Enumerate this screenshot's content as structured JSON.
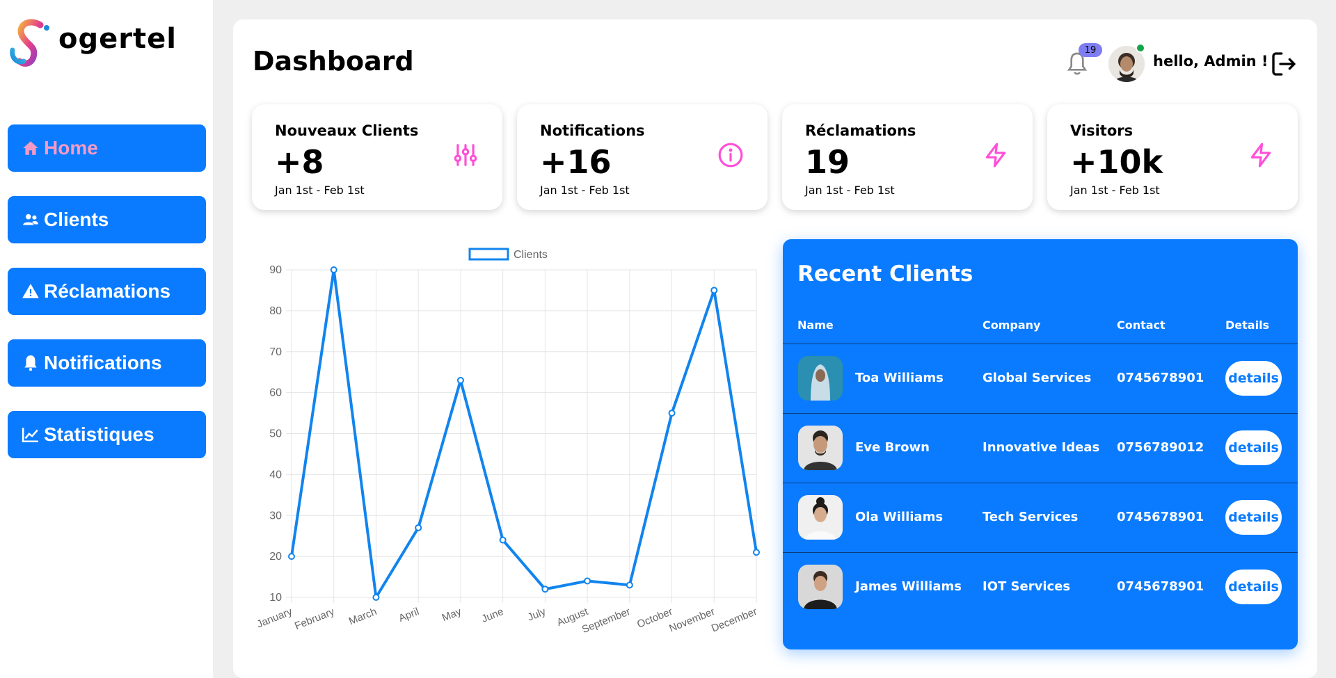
{
  "brand": {
    "name": "ogertel"
  },
  "sidebar": {
    "items": [
      {
        "label": "Home",
        "icon": "home-icon",
        "active": true
      },
      {
        "label": "Clients",
        "icon": "users-icon"
      },
      {
        "label": "Réclamations",
        "icon": "warning-icon"
      },
      {
        "label": "Notifications",
        "icon": "bell-icon"
      },
      {
        "label": "Statistiques",
        "icon": "chart-line-icon"
      }
    ]
  },
  "header": {
    "title": "Dashboard",
    "notification_count": "19",
    "greeting": "hello, Admin !"
  },
  "cards": [
    {
      "label": "Nouveaux Clients",
      "value": "+8",
      "range": "Jan 1st - Feb 1st",
      "icon": "sliders-icon"
    },
    {
      "label": "Notifications",
      "value": "+16",
      "range": "Jan 1st - Feb 1st",
      "icon": "info-icon"
    },
    {
      "label": "Réclamations",
      "value": "19",
      "range": "Jan 1st - Feb 1st",
      "icon": "lightning-icon"
    },
    {
      "label": "Visitors",
      "value": "+10k",
      "range": "Jan 1st - Feb 1st",
      "icon": "lightning-icon"
    }
  ],
  "chart_data": {
    "type": "line",
    "categories": [
      "January",
      "February",
      "March",
      "April",
      "May",
      "June",
      "July",
      "August",
      "September",
      "October",
      "November",
      "December"
    ],
    "series": [
      {
        "name": "Clients",
        "values": [
          20,
          90,
          10,
          27,
          63,
          24,
          12,
          14,
          13,
          55,
          85,
          21
        ]
      }
    ],
    "y_ticks": [
      10,
      20,
      30,
      40,
      50,
      60,
      70,
      80,
      90
    ],
    "ylim": [
      10,
      90
    ],
    "grid": true,
    "legend": "top",
    "color": "#1184ee"
  },
  "recent": {
    "title": "Recent Clients",
    "columns": [
      "Name",
      "Company",
      "Contact",
      "Details"
    ],
    "rows": [
      {
        "name": "Toa Williams",
        "company": "Global Services",
        "contact": "0745678901",
        "action": "details"
      },
      {
        "name": "Eve Brown",
        "company": "Innovative Ideas",
        "contact": "0756789012",
        "action": "details"
      },
      {
        "name": "Ola Williams",
        "company": "Tech Services",
        "contact": "0745678901",
        "action": "details"
      },
      {
        "name": "James Williams",
        "company": "IOT Services",
        "contact": "0745678901",
        "action": "details"
      }
    ]
  },
  "colors": {
    "accent": "#0a7bff",
    "pink": "#ff4fd8",
    "background": "#efefef"
  }
}
